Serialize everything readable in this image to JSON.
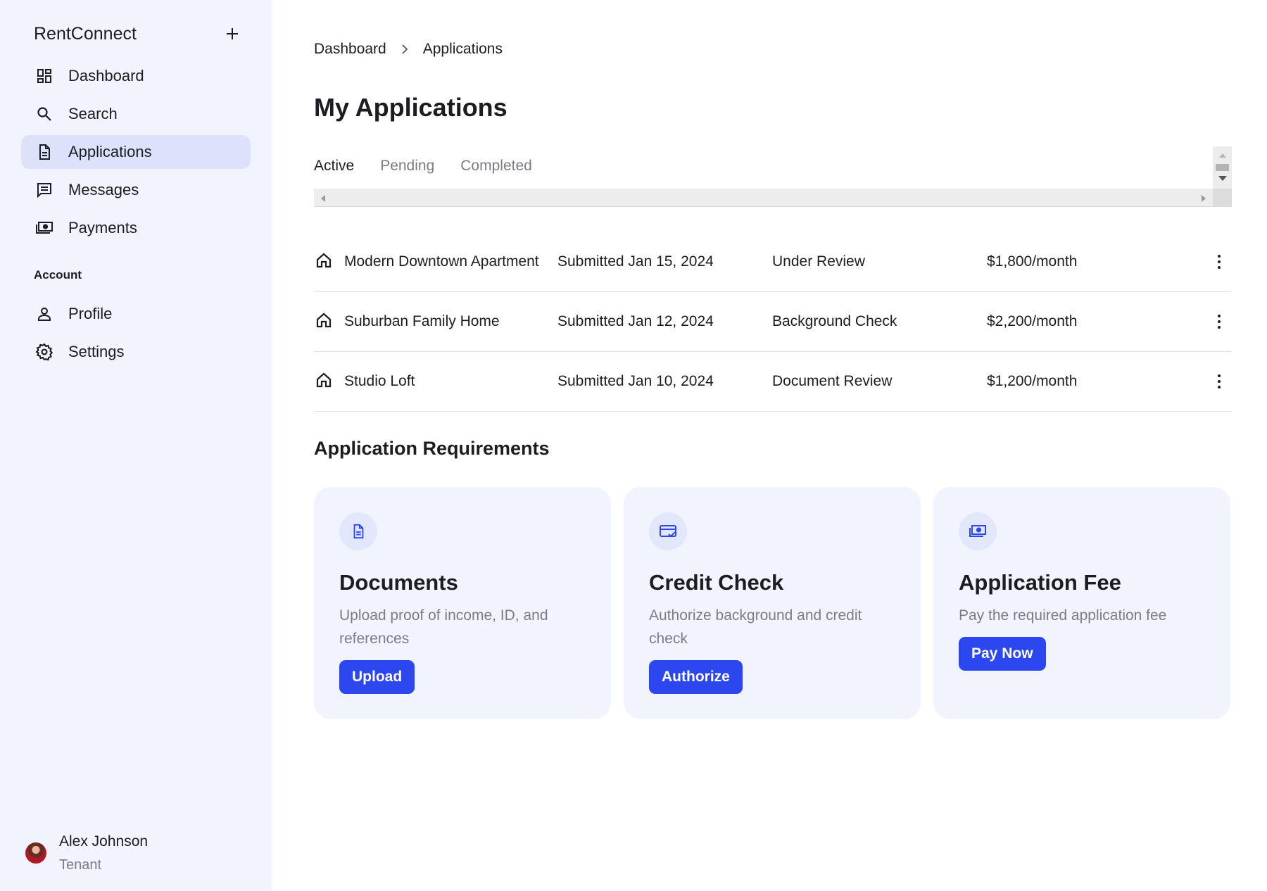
{
  "app": {
    "brand": "RentConnect"
  },
  "sidebar": {
    "items": [
      {
        "label": "Dashboard",
        "icon": "dashboard-icon"
      },
      {
        "label": "Search",
        "icon": "search-icon"
      },
      {
        "label": "Applications",
        "icon": "document-icon",
        "active": true
      },
      {
        "label": "Messages",
        "icon": "message-icon"
      },
      {
        "label": "Payments",
        "icon": "payments-icon"
      }
    ],
    "section_label": "Account",
    "account_items": [
      {
        "label": "Profile",
        "icon": "person-icon"
      },
      {
        "label": "Settings",
        "icon": "gear-icon"
      }
    ],
    "user": {
      "name": "Alex Johnson",
      "role": "Tenant"
    }
  },
  "breadcrumb": {
    "parent": "Dashboard",
    "current": "Applications"
  },
  "page": {
    "title": "My Applications"
  },
  "tabs": [
    "Active",
    "Pending",
    "Completed"
  ],
  "applications": [
    {
      "name": "Modern Downtown Apartment",
      "submitted": "Submitted Jan 15, 2024",
      "status": "Under Review",
      "price": "$1,800/month"
    },
    {
      "name": "Suburban Family Home",
      "submitted": "Submitted Jan 12, 2024",
      "status": "Background Check",
      "price": "$2,200/month"
    },
    {
      "name": "Studio Loft",
      "submitted": "Submitted Jan 10, 2024",
      "status": "Document Review",
      "price": "$1,200/month"
    }
  ],
  "requirements": {
    "title": "Application Requirements",
    "cards": [
      {
        "title": "Documents",
        "description": "Upload proof of income, ID, and references",
        "button": "Upload",
        "icon": "document-icon"
      },
      {
        "title": "Credit Check",
        "description": "Authorize background and credit check",
        "button": "Authorize",
        "icon": "credit-card-check-icon"
      },
      {
        "title": "Application Fee",
        "description": "Pay the required application fee",
        "button": "Pay Now",
        "icon": "payments-icon"
      }
    ]
  },
  "colors": {
    "accent": "#2c46f0",
    "sidebar_bg": "#f1f3fd",
    "active_nav_bg": "#dde2fb",
    "muted_text": "#7a7c86"
  }
}
